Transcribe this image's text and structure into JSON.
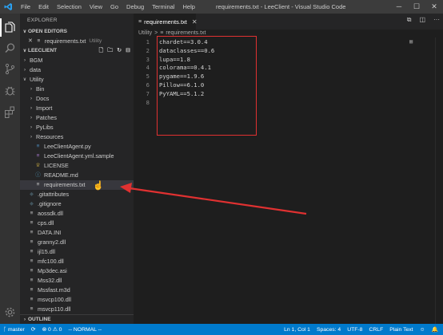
{
  "titlebar": {
    "menu": [
      "File",
      "Edit",
      "Selection",
      "View",
      "Go",
      "Debug",
      "Terminal",
      "Help"
    ],
    "window_title": "requirements.txt - LeeClient - Visual Studio Code",
    "controls": [
      "─",
      "☐",
      "✕"
    ]
  },
  "activitybar": {
    "icons": [
      "explorer-icon",
      "search-icon",
      "source-control-icon",
      "debug-icon",
      "extensions-icon",
      "settings-icon"
    ]
  },
  "sidebar": {
    "title": "EXPLORER",
    "open_editors": {
      "label": "OPEN EDITORS",
      "items": [
        {
          "name": "requirements.txt",
          "folder": "Utility"
        }
      ]
    },
    "workspace": {
      "label": "LEECLIENT",
      "items": [
        {
          "label": "BGM",
          "type": "folder",
          "depth": 0
        },
        {
          "label": "data",
          "type": "folder",
          "depth": 0
        },
        {
          "label": "Utility",
          "type": "folder-open",
          "depth": 0
        },
        {
          "label": "Bin",
          "type": "folder",
          "depth": 1
        },
        {
          "label": "Docs",
          "type": "folder",
          "depth": 1
        },
        {
          "label": "Import",
          "type": "folder",
          "depth": 1
        },
        {
          "label": "Patches",
          "type": "folder",
          "depth": 1
        },
        {
          "label": "PyLibs",
          "type": "folder",
          "depth": 1
        },
        {
          "label": "Resources",
          "type": "folder",
          "depth": 1
        },
        {
          "label": "LeeClientAgent.py",
          "type": "py",
          "depth": 1
        },
        {
          "label": "LeeClientAgent.yml.sample",
          "type": "yml",
          "depth": 1
        },
        {
          "label": "LICENSE",
          "type": "license",
          "depth": 1
        },
        {
          "label": "README.md",
          "type": "info",
          "depth": 1
        },
        {
          "label": "requirements.txt",
          "type": "txt",
          "depth": 1,
          "selected": true
        },
        {
          "label": ".gitattributes",
          "type": "git",
          "depth": 0
        },
        {
          "label": ".gitignore",
          "type": "git",
          "depth": 0
        },
        {
          "label": "aossdk.dll",
          "type": "txt",
          "depth": 0
        },
        {
          "label": "cps.dll",
          "type": "txt",
          "depth": 0
        },
        {
          "label": "DATA.INI",
          "type": "txt",
          "depth": 0
        },
        {
          "label": "granny2.dll",
          "type": "txt",
          "depth": 0
        },
        {
          "label": "ijl15.dll",
          "type": "txt",
          "depth": 0
        },
        {
          "label": "mfc100.dll",
          "type": "txt",
          "depth": 0
        },
        {
          "label": "Mp3dec.asi",
          "type": "txt",
          "depth": 0
        },
        {
          "label": "Mss32.dll",
          "type": "txt",
          "depth": 0
        },
        {
          "label": "Mssfast.m3d",
          "type": "txt",
          "depth": 0
        },
        {
          "label": "msvcp100.dll",
          "type": "txt",
          "depth": 0
        },
        {
          "label": "msvcp110.dll",
          "type": "txt",
          "depth": 0
        }
      ]
    },
    "outline_label": "OUTLINE"
  },
  "editor": {
    "tab_label": "requirements.txt",
    "breadcrumb": [
      "Utility",
      ">",
      "requirements.txt"
    ],
    "lines": [
      "chardet==3.0.4",
      "dataclasses==0.6",
      "lupa==1.8",
      "colorama==0.4.1",
      "pygame==1.9.6",
      "Pillow==6.1.0",
      "PyYAML==5.1.2",
      ""
    ]
  },
  "statusbar": {
    "branch": "master",
    "sync": "⟳",
    "problems": "⊗ 0 ⚠ 0",
    "mode": "-- NORMAL --",
    "position": "Ln 1, Col 1",
    "spaces": "Spaces: 4",
    "encoding": "UTF-8",
    "eol": "CRLF",
    "language": "Plain Text"
  },
  "colors": {
    "accent": "#007acc",
    "annotation_red": "#e03131"
  }
}
